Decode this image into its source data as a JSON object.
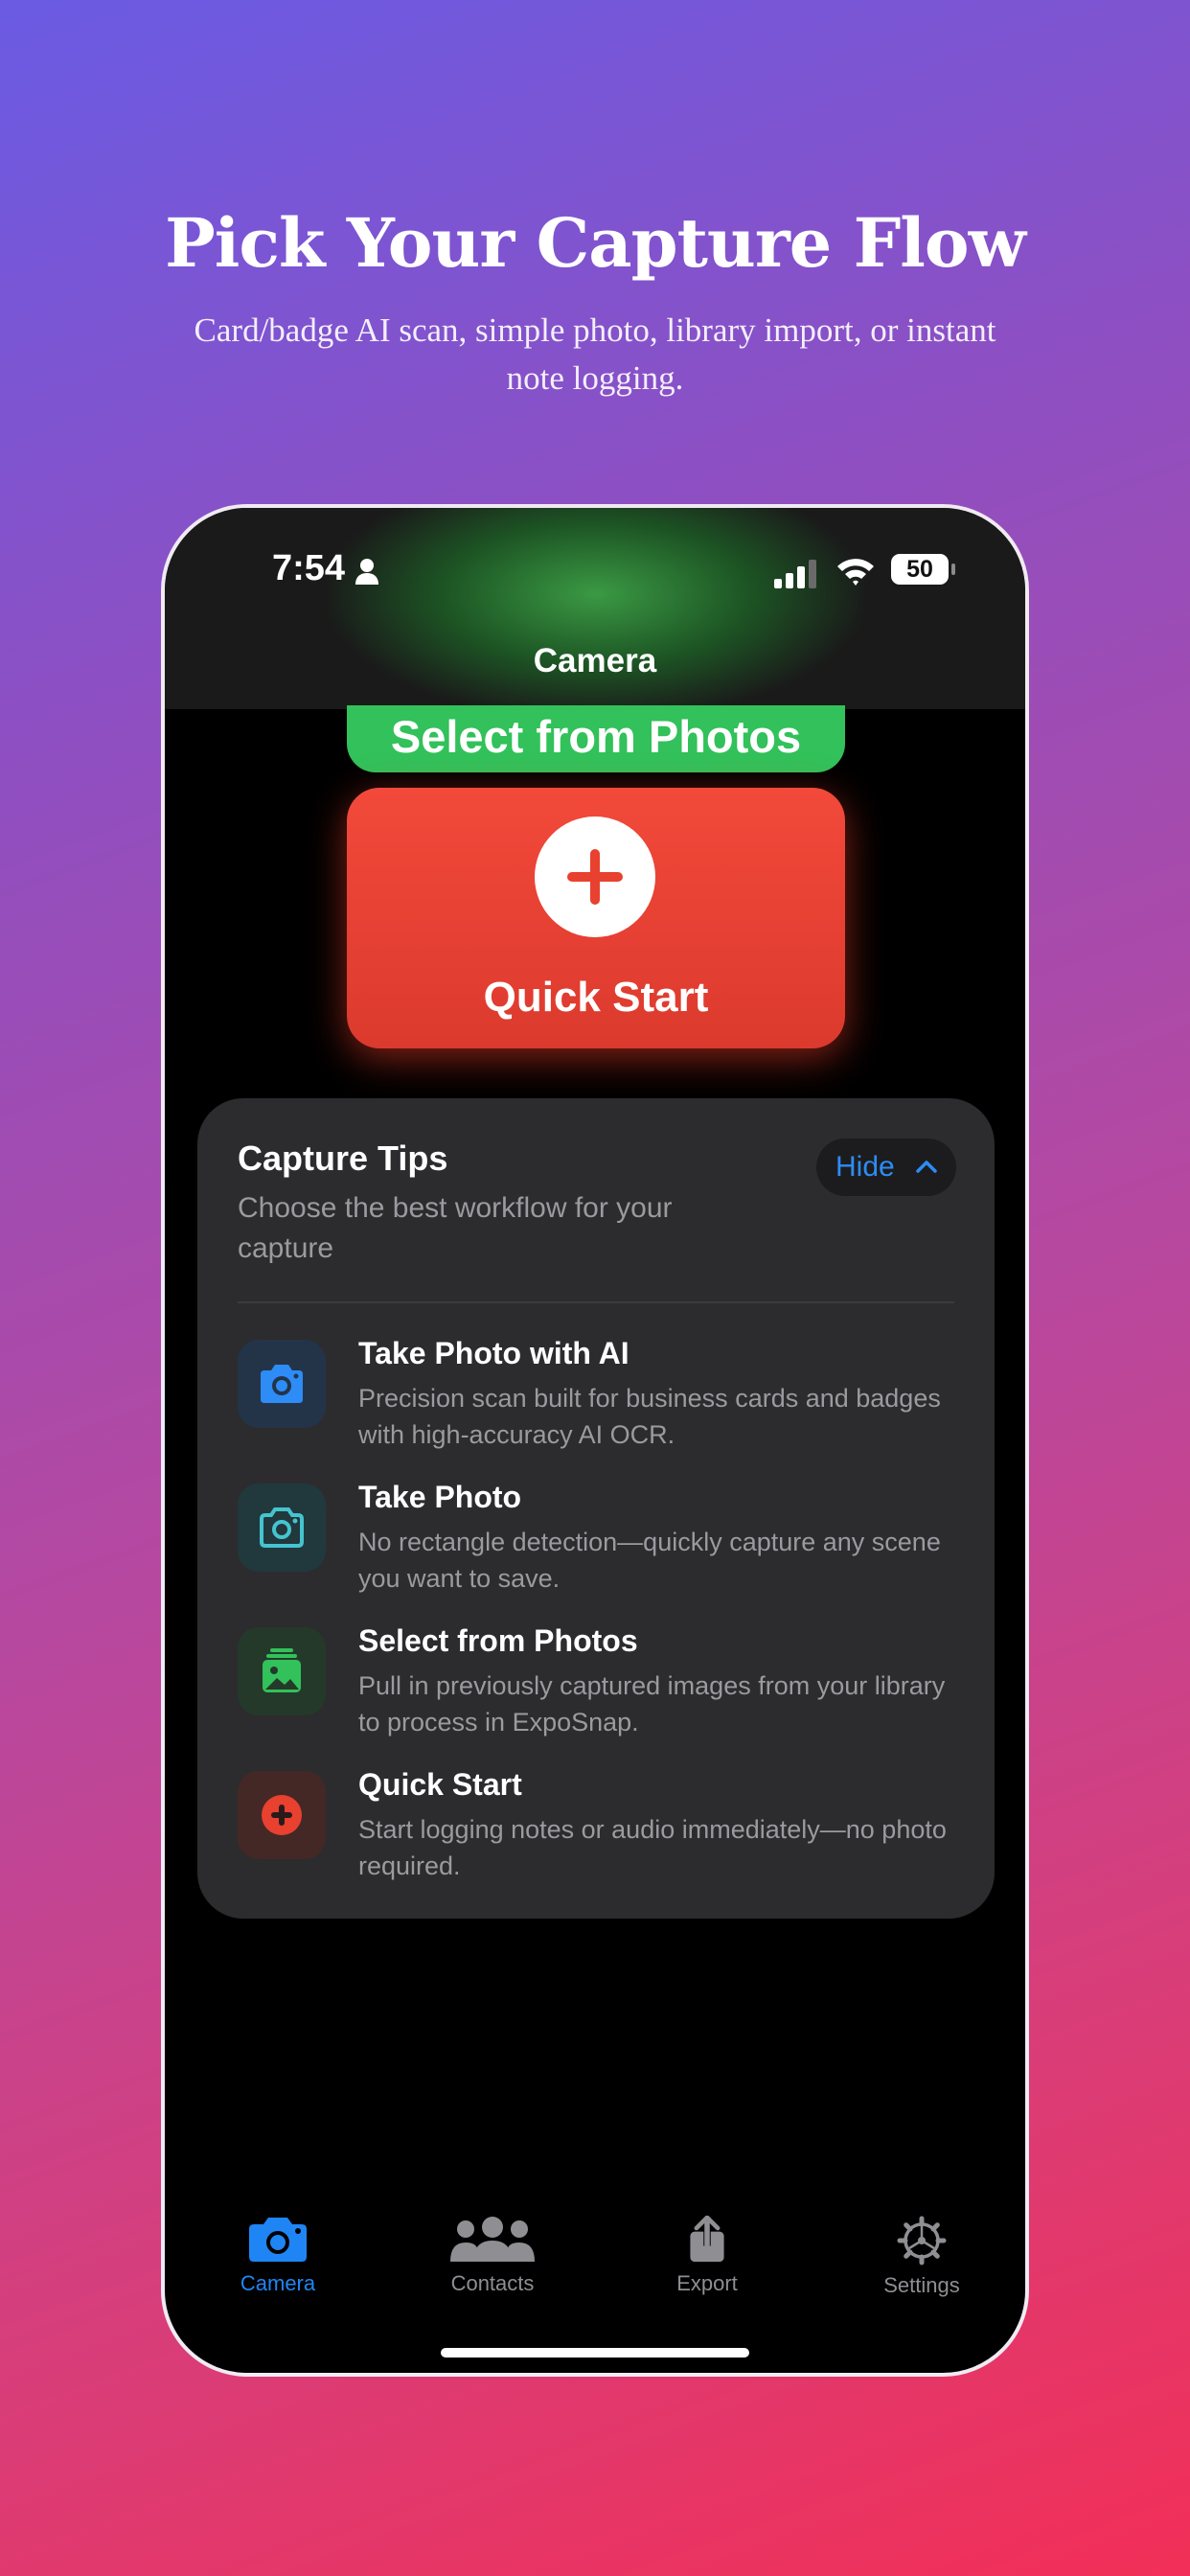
{
  "hero": {
    "title": "Pick Your Capture Flow",
    "subtitle": "Card/badge AI scan, simple photo, library import, or instant note logging."
  },
  "status_bar": {
    "time": "7:54",
    "battery": "50"
  },
  "nav": {
    "title": "Camera"
  },
  "actions": {
    "select_photos_label": "Select from Photos",
    "quick_start_label": "Quick Start"
  },
  "tips": {
    "title": "Capture Tips",
    "subtitle": "Choose the best workflow for your capture",
    "hide_label": "Hide",
    "items": [
      {
        "title": "Take Photo with AI",
        "description": "Precision scan built for business cards and badges with high-accuracy AI OCR.",
        "icon": "camera-filled-icon"
      },
      {
        "title": "Take Photo",
        "description": "No rectangle detection—quickly capture any scene you want to save.",
        "icon": "camera-outline-icon"
      },
      {
        "title": "Select from Photos",
        "description": "Pull in previously captured images from your library to process in ExpoSnap.",
        "icon": "photo-library-icon"
      },
      {
        "title": "Quick Start",
        "description": "Start logging notes or audio immediately—no photo required.",
        "icon": "plus-circle-icon"
      }
    ]
  },
  "tabbar": {
    "items": [
      {
        "label": "Camera",
        "icon": "camera-icon",
        "active": true
      },
      {
        "label": "Contacts",
        "icon": "people-icon",
        "active": false
      },
      {
        "label": "Export",
        "icon": "share-icon",
        "active": false
      },
      {
        "label": "Settings",
        "icon": "gear-icon",
        "active": false
      }
    ]
  },
  "colors": {
    "accent_blue": "#1f85f5",
    "photos_green": "#32c15a",
    "quick_red": "#e8412f",
    "card_bg": "#2c2c2e"
  }
}
